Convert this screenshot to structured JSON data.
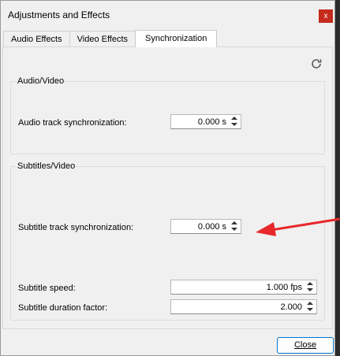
{
  "window": {
    "title": "Adjustments and Effects",
    "close_glyph": "x"
  },
  "tabs": [
    {
      "label": "Audio Effects",
      "active": false
    },
    {
      "label": "Video Effects",
      "active": false
    },
    {
      "label": "Synchronization",
      "active": true
    }
  ],
  "reset_icon": "refresh-icon",
  "audio_video": {
    "title": "Audio/Video",
    "audio_sync": {
      "label": "Audio track synchronization:",
      "value": "0.000 s"
    }
  },
  "subtitles_video": {
    "title": "Subtitles/Video",
    "subtitle_sync": {
      "label": "Subtitle track synchronization:",
      "value": "0.000 s"
    },
    "subtitle_speed": {
      "label": "Subtitle speed:",
      "value": "1.000 fps"
    },
    "subtitle_duration": {
      "label": "Subtitle duration factor:",
      "value": "2.000"
    }
  },
  "footer": {
    "close_label": "Close"
  },
  "colors": {
    "accent": "#0078d4",
    "annotation_arrow": "#e8282b",
    "close_red": "#c42b1c"
  }
}
